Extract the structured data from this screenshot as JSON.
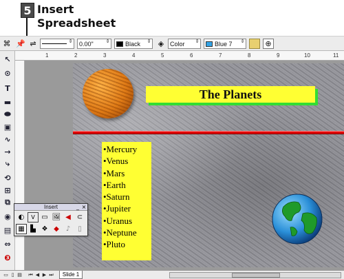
{
  "callout": {
    "step": "5",
    "title": "Insert\nSpreadsheet"
  },
  "toolbar": {
    "line_width": "0.00\"",
    "line_color": "Black",
    "line_color_hex": "#000000",
    "area_style": "Color",
    "area_color": "Blue 7",
    "area_color_hex": "#33a3e6"
  },
  "ruler_numbers": [
    "1",
    "2",
    "3",
    "4",
    "5",
    "6",
    "7",
    "8",
    "9",
    "10",
    "11"
  ],
  "slide": {
    "title": "The Planets",
    "planets": [
      "•Mercury",
      "•Venus",
      "•Mars",
      "•Earth",
      "•Saturn",
      "•Jupiter",
      "•Uranus",
      "•Neptune",
      "•Pluto"
    ],
    "colors": {
      "title_bg": "#ffff33",
      "title_shadow": "#33dd33",
      "list_bg": "#ffff33",
      "rule": "#e00000"
    }
  },
  "insert_toolbar": {
    "title": "Insert",
    "minimize": "_",
    "close": "×"
  },
  "tabs": {
    "slide_tab": "Slide 1"
  }
}
